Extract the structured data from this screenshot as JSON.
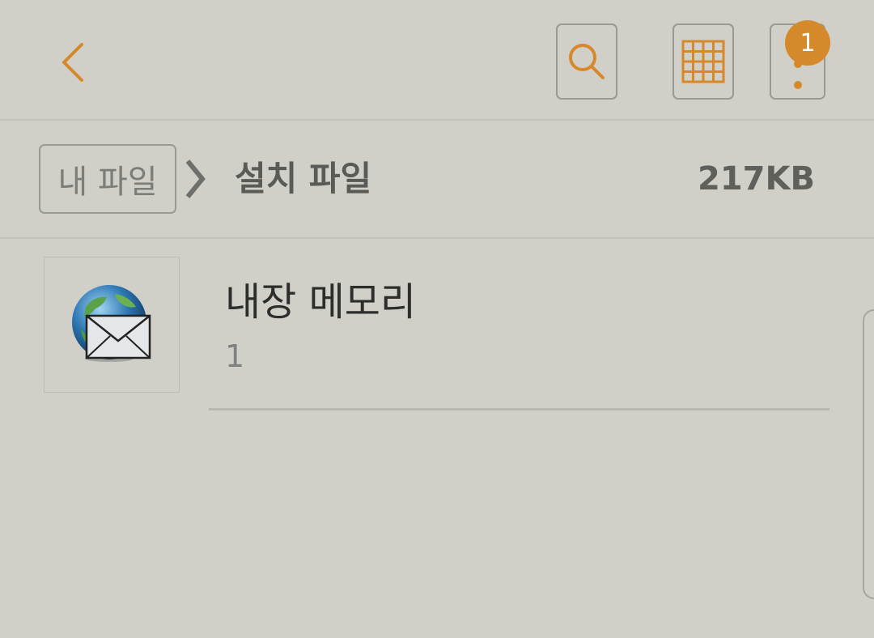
{
  "toolbar": {
    "back_icon": "chevron-left-icon",
    "search_icon": "search-icon",
    "grid_icon": "grid-view-icon",
    "more_icon": "more-vert-icon",
    "badge_count": "1",
    "accent_color": "#d6892a"
  },
  "breadcrumb": {
    "root_label": "내 파일",
    "separator_icon": "chevron-right-icon",
    "current_label": "설치 파일",
    "size": "217KB"
  },
  "list": {
    "items": [
      {
        "title": "내장 메모리",
        "count": "1",
        "icon": "globe-mail-icon"
      }
    ]
  }
}
